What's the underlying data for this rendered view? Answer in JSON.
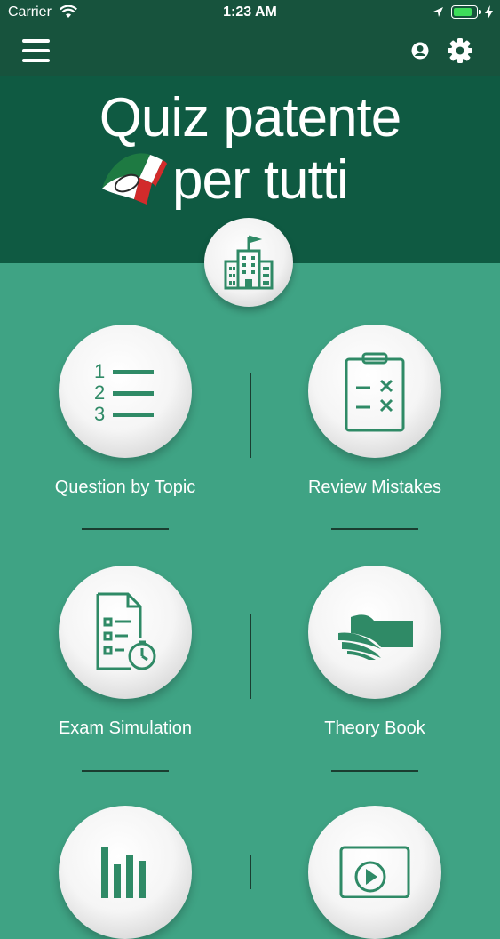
{
  "status": {
    "carrier": "Carrier",
    "time": "1:23 AM",
    "battery_level": 0.85
  },
  "nav": {
    "menu_icon": "hamburger-icon",
    "user_icon": "user-icon",
    "settings_icon": "gear-icon"
  },
  "banner": {
    "title_line1": "Quiz patente",
    "title_line2": "per tutti",
    "logo_icon": "italian-flag-car-icon"
  },
  "top_button": {
    "icon": "building-icon"
  },
  "tiles": [
    {
      "label": "Question by Topic",
      "icon": "numbered-list-icon"
    },
    {
      "label": "Review Mistakes",
      "icon": "clipboard-check-icon"
    },
    {
      "label": "Exam Simulation",
      "icon": "timed-exam-icon"
    },
    {
      "label": "Theory Book",
      "icon": "book-icon"
    },
    {
      "label": "",
      "icon": "bar-chart-icon"
    },
    {
      "label": "",
      "icon": "video-play-icon"
    }
  ],
  "colors": {
    "header": "#17533d",
    "banner": "#0f5a42",
    "body": "#3fa384",
    "icon": "#2f8a66"
  }
}
